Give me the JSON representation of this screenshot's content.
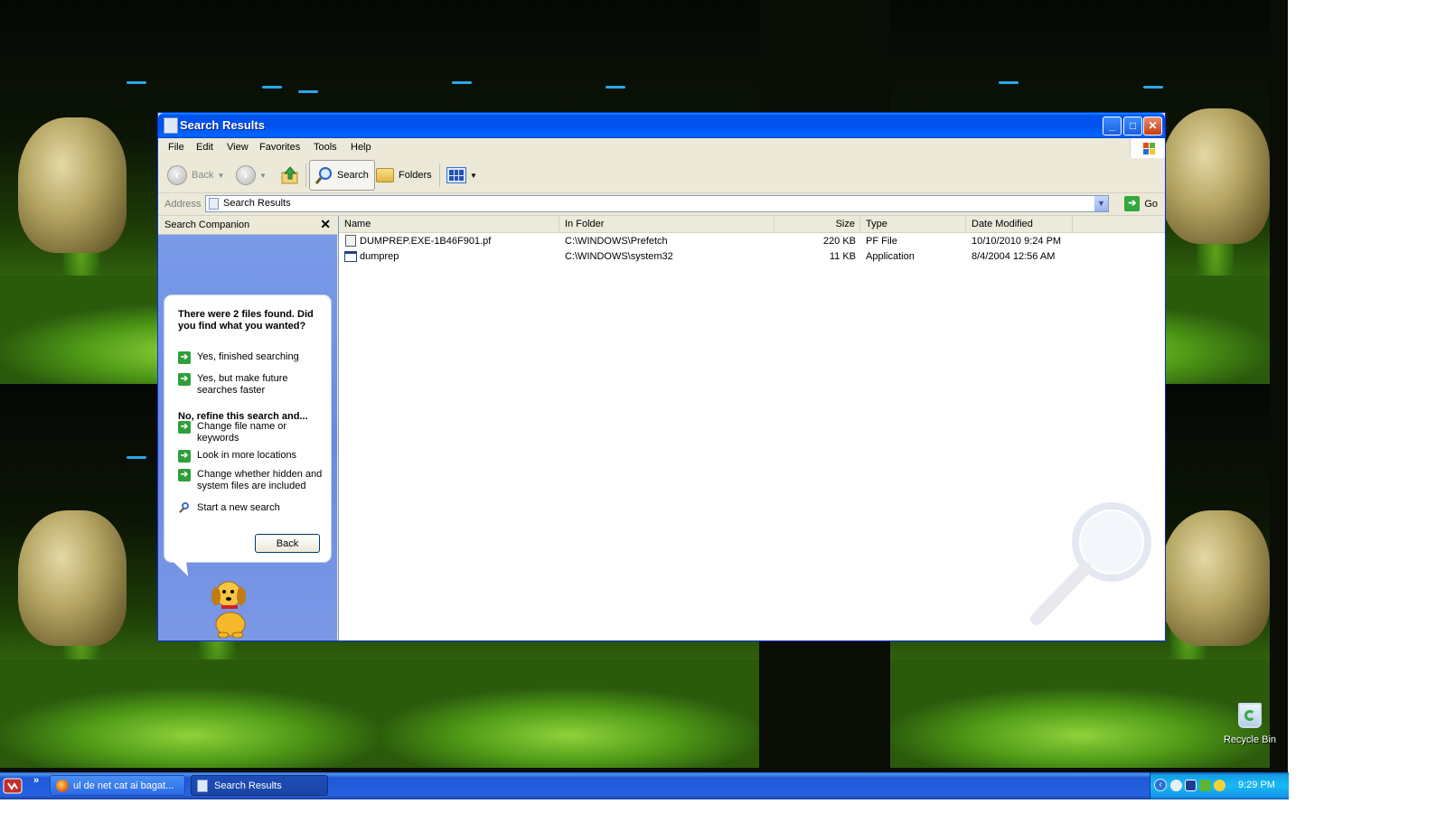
{
  "window": {
    "title": "Search Results"
  },
  "menu": [
    "File",
    "Edit",
    "View",
    "Favorites",
    "Tools",
    "Help"
  ],
  "toolbar": {
    "back_label": "Back",
    "search_label": "Search",
    "folders_label": "Folders"
  },
  "address": {
    "label": "Address",
    "value": "Search Results",
    "go_label": "Go"
  },
  "companion": {
    "header": "Search Companion",
    "question": "There were 2 files found. Did you find what you wanted?",
    "options_yes": [
      "Yes, finished searching",
      "Yes, but make future searches faster"
    ],
    "refine_heading": "No, refine this search and...",
    "options_refine": [
      "Change file name or keywords",
      "Look in more locations",
      "Change whether hidden and system files are included"
    ],
    "new_search": "Start a new search",
    "back_button": "Back"
  },
  "results": {
    "columns": [
      "Name",
      "In Folder",
      "Size",
      "Type",
      "Date Modified"
    ],
    "rows": [
      {
        "name": "DUMPREP.EXE-1B46F901.pf",
        "folder": "C:\\WINDOWS\\Prefetch",
        "size": "220 KB",
        "type": "PF File",
        "modified": "10/10/2010 9:24 PM",
        "icon": "pf-file-icon"
      },
      {
        "name": "dumprep",
        "folder": "C:\\WINDOWS\\system32",
        "size": "11 KB",
        "type": "Application",
        "modified": "8/4/2004 12:56 AM",
        "icon": "application-icon"
      }
    ]
  },
  "taskbar": {
    "tasks": [
      "ul de net cat ai bagat...",
      "Search Results"
    ],
    "clock": "9:29 PM"
  },
  "desktop": {
    "recycle_bin": "Recycle Bin"
  },
  "colors": {
    "title_blue": "#0054e3",
    "companion_blue": "#6f8fe2",
    "taskbar_blue": "#245edb",
    "tray_blue": "#0f9be6",
    "arrow_green": "#2f9f3b"
  }
}
